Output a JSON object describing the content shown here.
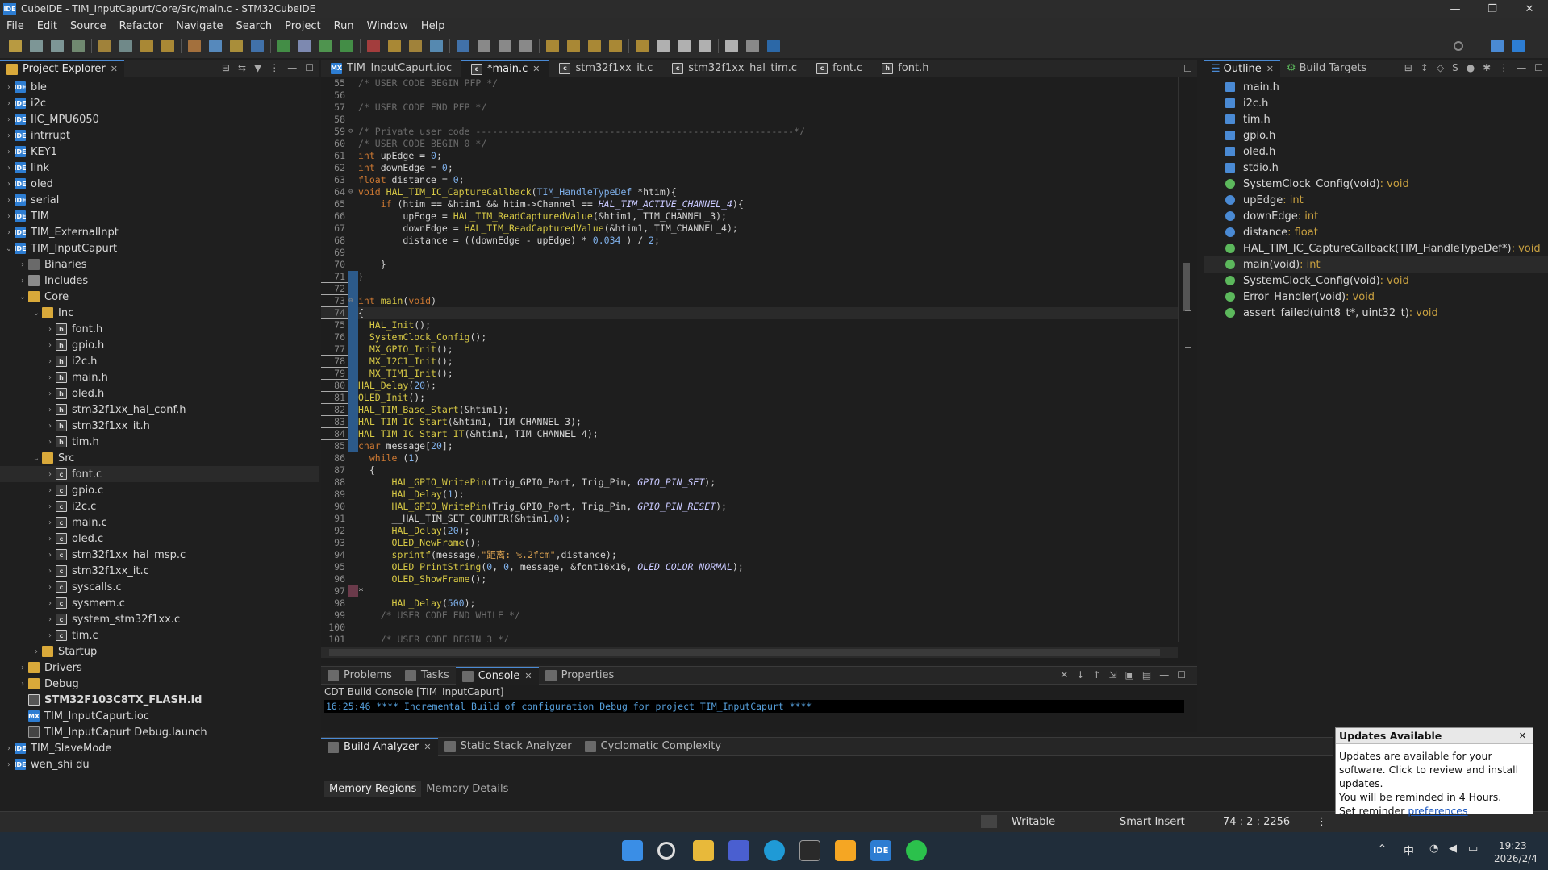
{
  "window": {
    "title": "CubeIDE - TIM_InputCapurt/Core/Src/main.c - STM32CubeIDE",
    "icon_text": "IDE"
  },
  "menu": [
    "File",
    "Edit",
    "Source",
    "Refactor",
    "Navigate",
    "Search",
    "Project",
    "Run",
    "Window",
    "Help"
  ],
  "project_explorer": {
    "tab_label": "Project Explorer",
    "items": [
      {
        "label": "ble",
        "depth": 0,
        "icon": "project-icon",
        "arrow": "›"
      },
      {
        "label": "i2c",
        "depth": 0,
        "icon": "project-icon",
        "arrow": "›"
      },
      {
        "label": "IIC_MPU6050",
        "depth": 0,
        "icon": "project-icon",
        "arrow": "›"
      },
      {
        "label": "intrrupt",
        "depth": 0,
        "icon": "project-icon",
        "arrow": "›"
      },
      {
        "label": "KEY1",
        "depth": 0,
        "icon": "project-icon",
        "arrow": "›"
      },
      {
        "label": "link",
        "depth": 0,
        "icon": "project-icon",
        "arrow": "›"
      },
      {
        "label": "oled",
        "depth": 0,
        "icon": "project-icon",
        "arrow": "›"
      },
      {
        "label": "serial",
        "depth": 0,
        "icon": "project-icon",
        "arrow": "›"
      },
      {
        "label": "TIM",
        "depth": 0,
        "icon": "project-icon",
        "arrow": "›"
      },
      {
        "label": "TIM_ExternalInpt",
        "depth": 0,
        "icon": "project-icon",
        "arrow": "›"
      },
      {
        "label": "TIM_InputCapurt",
        "depth": 0,
        "icon": "project-icon",
        "arrow": "⌄"
      },
      {
        "label": "Binaries",
        "depth": 1,
        "icon": "binaries-icon",
        "arrow": "›"
      },
      {
        "label": "Includes",
        "depth": 1,
        "icon": "includes-icon",
        "arrow": "›"
      },
      {
        "label": "Core",
        "depth": 1,
        "icon": "folder-icon",
        "arrow": "⌄"
      },
      {
        "label": "Inc",
        "depth": 2,
        "icon": "folder-icon",
        "arrow": "⌄"
      },
      {
        "label": "font.h",
        "depth": 3,
        "icon": "header-file-icon",
        "arrow": "›"
      },
      {
        "label": "gpio.h",
        "depth": 3,
        "icon": "header-file-icon",
        "arrow": "›"
      },
      {
        "label": "i2c.h",
        "depth": 3,
        "icon": "header-file-icon",
        "arrow": "›"
      },
      {
        "label": "main.h",
        "depth": 3,
        "icon": "header-file-icon",
        "arrow": "›"
      },
      {
        "label": "oled.h",
        "depth": 3,
        "icon": "header-file-icon",
        "arrow": "›"
      },
      {
        "label": "stm32f1xx_hal_conf.h",
        "depth": 3,
        "icon": "header-file-icon",
        "arrow": "›"
      },
      {
        "label": "stm32f1xx_it.h",
        "depth": 3,
        "icon": "header-file-icon",
        "arrow": "›"
      },
      {
        "label": "tim.h",
        "depth": 3,
        "icon": "header-file-icon",
        "arrow": "›"
      },
      {
        "label": "Src",
        "depth": 2,
        "icon": "folder-icon",
        "arrow": "⌄"
      },
      {
        "label": "font.c",
        "depth": 3,
        "icon": "source-file-icon",
        "arrow": "›",
        "selected": true
      },
      {
        "label": "gpio.c",
        "depth": 3,
        "icon": "source-file-icon",
        "arrow": "›"
      },
      {
        "label": "i2c.c",
        "depth": 3,
        "icon": "source-file-icon",
        "arrow": "›"
      },
      {
        "label": "main.c",
        "depth": 3,
        "icon": "source-file-icon",
        "arrow": "›"
      },
      {
        "label": "oled.c",
        "depth": 3,
        "icon": "source-file-icon",
        "arrow": "›"
      },
      {
        "label": "stm32f1xx_hal_msp.c",
        "depth": 3,
        "icon": "source-file-icon",
        "arrow": "›"
      },
      {
        "label": "stm32f1xx_it.c",
        "depth": 3,
        "icon": "source-file-icon",
        "arrow": "›"
      },
      {
        "label": "syscalls.c",
        "depth": 3,
        "icon": "source-file-icon",
        "arrow": "›"
      },
      {
        "label": "sysmem.c",
        "depth": 3,
        "icon": "source-file-icon",
        "arrow": "›"
      },
      {
        "label": "system_stm32f1xx.c",
        "depth": 3,
        "icon": "source-file-icon",
        "arrow": "›"
      },
      {
        "label": "tim.c",
        "depth": 3,
        "icon": "source-file-icon",
        "arrow": "›"
      },
      {
        "label": "Startup",
        "depth": 2,
        "icon": "folder-icon",
        "arrow": "›"
      },
      {
        "label": "Drivers",
        "depth": 1,
        "icon": "folder-icon",
        "arrow": "›"
      },
      {
        "label": "Debug",
        "depth": 1,
        "icon": "folder-icon",
        "arrow": "›"
      },
      {
        "label": "STM32F103C8TX_FLASH.ld",
        "depth": 1,
        "icon": "linker-file-icon",
        "arrow": "",
        "bold": true
      },
      {
        "label": "TIM_InputCapurt.ioc",
        "depth": 1,
        "icon": "ioc-file-icon",
        "arrow": ""
      },
      {
        "label": "TIM_InputCapurt Debug.launch",
        "depth": 1,
        "icon": "launch-file-icon",
        "arrow": ""
      },
      {
        "label": "TIM_SlaveMode",
        "depth": 0,
        "icon": "project-icon",
        "arrow": "›"
      },
      {
        "label": "wen_shi du",
        "depth": 0,
        "icon": "project-icon",
        "arrow": "›"
      }
    ]
  },
  "editor": {
    "tabs": [
      {
        "label": "TIM_InputCapurt.ioc",
        "active": false
      },
      {
        "label": "*main.c",
        "active": true
      },
      {
        "label": "stm32f1xx_it.c",
        "active": false
      },
      {
        "label": "stm32f1xx_hal_tim.c",
        "active": false
      },
      {
        "label": "font.c",
        "active": false
      },
      {
        "label": "font.h",
        "active": false
      }
    ],
    "lines": [
      {
        "n": "55",
        "html": "<span class=\"cm\">/* USER CODE BEGIN PFP */</span>"
      },
      {
        "n": "56",
        "html": ""
      },
      {
        "n": "57",
        "html": "<span class=\"cm\">/* USER CODE END PFP */</span>"
      },
      {
        "n": "58",
        "html": ""
      },
      {
        "n": "59",
        "html": "<span class=\"cm\">/* Private user code ---------------------------------------------------------*/</span>"
      },
      {
        "n": "60",
        "html": "<span class=\"cm\">/* USER CODE BEGIN 0 */</span>"
      },
      {
        "n": "61",
        "html": "<span class=\"kw\">int</span> upEdge = <span class=\"num\">0</span>;"
      },
      {
        "n": "62",
        "html": "<span class=\"kw\">int</span> downEdge = <span class=\"num\">0</span>;"
      },
      {
        "n": "63",
        "html": "<span class=\"kw\">float</span> distance = <span class=\"num\">0</span>;"
      },
      {
        "n": "64",
        "html": "<span class=\"kw\">void</span> <span class=\"fn\">HAL_TIM_IC_CaptureCallback</span>(<span class=\"num\">TIM_HandleTypeDef</span> *htim){"
      },
      {
        "n": "65",
        "html": "    <span class=\"kw\">if</span> (htim == &amp;htim1 &amp;&amp; htim-&gt;Channel == <span class=\"it\">HAL_TIM_ACTIVE_CHANNEL_4</span>){"
      },
      {
        "n": "66",
        "html": "        upEdge = <span class=\"fn\">HAL_TIM_ReadCapturedValue</span>(&amp;htim1, TIM_CHANNEL_3);"
      },
      {
        "n": "67",
        "html": "        downEdge = <span class=\"fn\">HAL_TIM_ReadCapturedValue</span>(&amp;htim1, TIM_CHANNEL_4);"
      },
      {
        "n": "68",
        "html": "        distance = ((downEdge - upEdge) * <span class=\"num\">0.034</span> ) / <span class=\"num\">2</span>;"
      },
      {
        "n": "69",
        "html": ""
      },
      {
        "n": "70",
        "html": "    }"
      },
      {
        "n": "71",
        "html": "}"
      },
      {
        "n": "72",
        "html": ""
      },
      {
        "n": "73",
        "html": "<span class=\"kw\">int</span> <span class=\"fn\">main</span>(<span class=\"kw\">void</span>)"
      },
      {
        "n": "74",
        "html": "{"
      },
      {
        "n": "75",
        "html": "  <span class=\"fn\">HAL_Init</span>();"
      },
      {
        "n": "76",
        "html": "  <span class=\"fn\">SystemClock_Config</span>();"
      },
      {
        "n": "77",
        "html": "  <span class=\"fn\">MX_GPIO_Init</span>();"
      },
      {
        "n": "78",
        "html": "  <span class=\"fn\">MX_I2C1_Init</span>();"
      },
      {
        "n": "79",
        "html": "  <span class=\"fn\">MX_TIM1_Init</span>();"
      },
      {
        "n": "80",
        "html": "<span class=\"fn\">HAL_Delay</span>(<span class=\"num\">20</span>);"
      },
      {
        "n": "81",
        "html": "<span class=\"fn\">OLED_Init</span>();"
      },
      {
        "n": "82",
        "html": "<span class=\"fn\">HAL_TIM_Base_Start</span>(&amp;htim1);"
      },
      {
        "n": "83",
        "html": "<span class=\"fn\">HAL_TIM_IC_Start</span>(&amp;htim1, TIM_CHANNEL_3);"
      },
      {
        "n": "84",
        "html": "<span class=\"fn\">HAL_TIM_IC_Start_IT</span>(&amp;htim1, TIM_CHANNEL_4);"
      },
      {
        "n": "85",
        "html": "<span class=\"kw\">char</span> message[<span class=\"num\">20</span>];"
      },
      {
        "n": "86",
        "html": "  <span class=\"kw\">while</span> (<span class=\"num\">1</span>)"
      },
      {
        "n": "87",
        "html": "  {"
      },
      {
        "n": "88",
        "html": "      <span class=\"fn\">HAL_GPIO_WritePin</span>(Trig_GPIO_Port, Trig_Pin, <span class=\"it\">GPIO_PIN_SET</span>);"
      },
      {
        "n": "89",
        "html": "      <span class=\"fn\">HAL_Delay</span>(<span class=\"num\">1</span>);"
      },
      {
        "n": "90",
        "html": "      <span class=\"fn\">HAL_GPIO_WritePin</span>(Trig_GPIO_Port, Trig_Pin, <span class=\"it\">GPIO_PIN_RESET</span>);"
      },
      {
        "n": "91",
        "html": "      __HAL_TIM_SET_COUNTER(&amp;htim1,<span class=\"num\">0</span>);"
      },
      {
        "n": "92",
        "html": "      <span class=\"fn\">HAL_Delay</span>(<span class=\"num\">20</span>);"
      },
      {
        "n": "93",
        "html": "      <span class=\"fn\">OLED_NewFrame</span>();"
      },
      {
        "n": "94",
        "html": "      <span class=\"fn\">sprintf</span>(message,<span class=\"str\">\"距离: %.2fcm\"</span>,distance);"
      },
      {
        "n": "95",
        "html": "      <span class=\"fn\">OLED_PrintString</span>(<span class=\"num\">0</span>, <span class=\"num\">0</span>, message, &amp;font16x16, <span class=\"it\">OLED_COLOR_NORMAL</span>);"
      },
      {
        "n": "96",
        "html": "      <span class=\"fn\">OLED_ShowFrame</span>();"
      },
      {
        "n": "97",
        "html": "*"
      },
      {
        "n": "98",
        "html": "      <span class=\"fn\">HAL_Delay</span>(<span class=\"num\">500</span>);"
      },
      {
        "n": "99",
        "html": "    <span class=\"cm\">/* USER CODE END WHILE */</span>"
      },
      {
        "n": "100",
        "html": ""
      },
      {
        "n": "101",
        "html": "    <span class=\"cm\">/* USER CODE BEGIN 3 */</span>"
      }
    ]
  },
  "outline": {
    "tabs": [
      "Outline",
      "Build Targets"
    ],
    "items": [
      {
        "label": "main.h",
        "type": "",
        "icon": "include-icon"
      },
      {
        "label": "i2c.h",
        "type": "",
        "icon": "include-icon"
      },
      {
        "label": "tim.h",
        "type": "",
        "icon": "include-icon"
      },
      {
        "label": "gpio.h",
        "type": "",
        "icon": "include-icon"
      },
      {
        "label": "oled.h",
        "type": "",
        "icon": "include-icon"
      },
      {
        "label": "stdio.h",
        "type": "",
        "icon": "include-icon"
      },
      {
        "label": "SystemClock_Config(void)",
        "type": " : void",
        "icon": "declaration-icon"
      },
      {
        "label": "upEdge",
        "type": " : int",
        "icon": "variable-icon"
      },
      {
        "label": "downEdge",
        "type": " : int",
        "icon": "variable-icon"
      },
      {
        "label": "distance",
        "type": " : float",
        "icon": "variable-icon"
      },
      {
        "label": "HAL_TIM_IC_CaptureCallback(TIM_HandleTypeDef*)",
        "type": " : void",
        "icon": "function-icon"
      },
      {
        "label": "main(void)",
        "type": " : int",
        "icon": "function-icon",
        "selected": true
      },
      {
        "label": "SystemClock_Config(void)",
        "type": " : void",
        "icon": "function-icon"
      },
      {
        "label": "Error_Handler(void)",
        "type": " : void",
        "icon": "function-icon"
      },
      {
        "label": "assert_failed(uint8_t*, uint32_t)",
        "type": " : void",
        "icon": "function-icon"
      }
    ]
  },
  "console": {
    "tabs": [
      "Problems",
      "Tasks",
      "Console",
      "Properties"
    ],
    "label": "CDT Build Console [TIM_InputCapurt]",
    "line": "16:25:46 **** Incremental Build of configuration Debug for project TIM_InputCapurt ****"
  },
  "analyzer": {
    "tabs": [
      "Build Analyzer",
      "Static Stack Analyzer",
      "Cyclomatic Complexity"
    ],
    "subtabs": [
      "Memory Regions",
      "Memory Details"
    ]
  },
  "status": {
    "writable": "Writable",
    "insert": "Smart Insert",
    "position": "74 : 2 : 2256"
  },
  "notification": {
    "title": "Updates Available",
    "line1": "Updates are available for your software. Click to review and install updates.",
    "line2": "You will be reminded in 4 Hours.",
    "line3_prefix": "Set reminder ",
    "link": "preferences"
  },
  "taskbar": {
    "time": "19:23",
    "date": "2026/2/4",
    "ime": "中"
  },
  "colors": {
    "accent": "#4a8ad4",
    "project_icon": "#2d7dd2",
    "folder_icon": "#d9a93a",
    "keyword": "#cc7832",
    "function": "#d6c845",
    "comment": "#6a6a6a",
    "number": "#7fb0ea"
  }
}
